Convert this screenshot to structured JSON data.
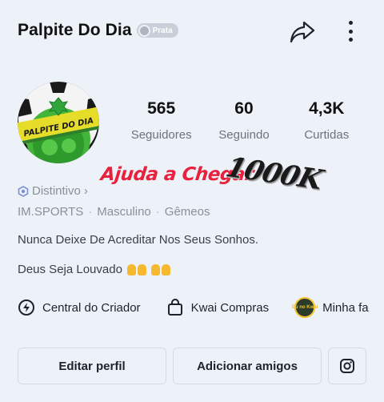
{
  "header": {
    "title": "Palpite Do Dia",
    "badge": "Prata",
    "share_icon": "share-arrow-icon",
    "more_icon": "more-vertical-icon"
  },
  "avatar": {
    "logo_text": "PALPITE DO DIA",
    "colors": {
      "ball": "#3fae3a",
      "banner": "#e6dd2a"
    }
  },
  "stats": [
    {
      "value": "565",
      "label": "Seguidores"
    },
    {
      "value": "60",
      "label": "Seguindo"
    },
    {
      "value": "4,3K",
      "label": "Curtidas"
    }
  ],
  "promo": {
    "text": "Ajuda a Chegar",
    "target": "1000K"
  },
  "profile": {
    "distintivo": "Distintivo",
    "meta": [
      "IM.SPORTS",
      "Masculino",
      "Gêmeos"
    ],
    "bio_line1": "Nunca Deixe De Acreditar Nos Seus Sonhos.",
    "bio_line2": "Deus Seja Louvado"
  },
  "shortcuts": [
    {
      "label": "Central do Criador",
      "icon": "lightning-icon"
    },
    {
      "label": "Kwai Compras",
      "icon": "shopping-bag-icon"
    },
    {
      "label": "Minha fa",
      "icon": "kwai-logo-icon",
      "logo_text": "Eu no Kwai"
    }
  ],
  "actions": {
    "edit": "Editar perfil",
    "add": "Adicionar amigos",
    "instagram_icon": "instagram-icon"
  },
  "colors": {
    "background": "#edf2f9",
    "promo_red": "#e8213d"
  }
}
